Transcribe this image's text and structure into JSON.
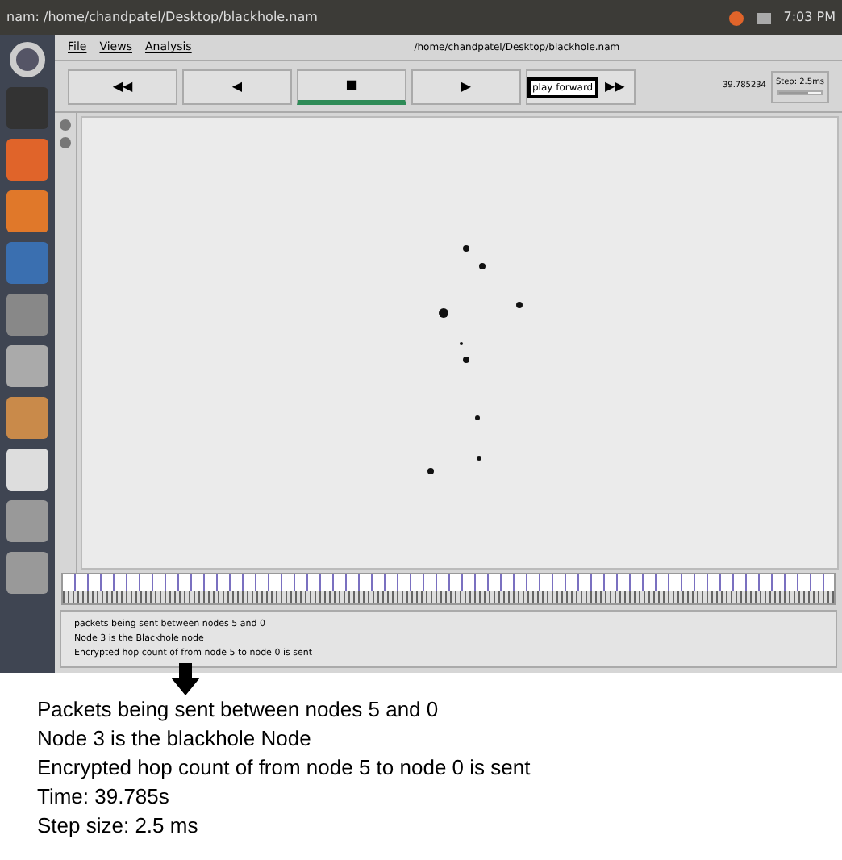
{
  "top_bar": {
    "title": "nam: /home/chandpatel/Desktop/blackhole.nam",
    "clock": "7:03 PM"
  },
  "menu": [
    "File",
    "Views",
    "Analysis"
  ],
  "window": {
    "title": "/home/chandpatel/Desktop/blackhole.nam"
  },
  "controls": [
    {
      "label": "◀◀",
      "selected": false
    },
    {
      "label": "◀",
      "selected": false
    },
    {
      "label": "■",
      "selected": true
    },
    {
      "label": "▶",
      "selected": false
    },
    {
      "label": "▶▶",
      "selected": false
    }
  ],
  "tooltip": "play forward",
  "time": "39.785234",
  "step": "Step: 2.5ms",
  "step_slider": {
    "level": 0.7
  },
  "annotations": [
    "packets being sent between nodes 5 and 0",
    "Node 3 is the Blackhole node",
    "Encrypted hop count of from node 5 to node 0 is sent"
  ],
  "caption": [
    "Packets being sent between nodes 5 and 0",
    "Node 3 is the blackhole Node",
    "Encrypted hop count of from node 5 to node 0 is sent",
    "Time: 39.785s",
    "Step size: 2.5 ms"
  ]
}
